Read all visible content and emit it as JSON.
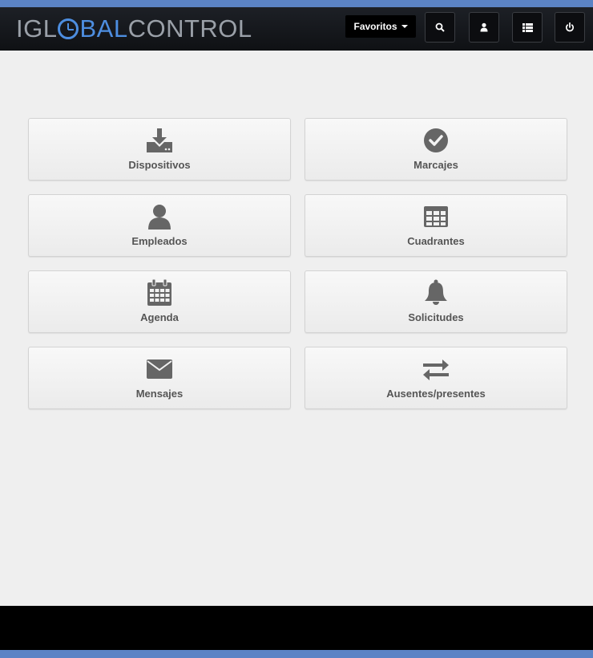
{
  "header": {
    "logo_prefix": "IGL",
    "logo_middle": "BAL",
    "logo_suffix": "CONTROL",
    "favorites_label": "Favoritos",
    "icons": [
      "search-icon",
      "user-icon",
      "list-icon",
      "power-icon"
    ]
  },
  "tiles": [
    {
      "label": "Dispositivos",
      "icon": "download-icon"
    },
    {
      "label": "Marcajes",
      "icon": "check-circle-icon"
    },
    {
      "label": "Empleados",
      "icon": "user-icon"
    },
    {
      "label": "Cuadrantes",
      "icon": "table-icon"
    },
    {
      "label": "Agenda",
      "icon": "calendar-icon"
    },
    {
      "label": "Solicitudes",
      "icon": "bell-icon"
    },
    {
      "label": "Mensajes",
      "icon": "envelope-icon"
    },
    {
      "label": "Ausentes/presentes",
      "icon": "exchange-icon"
    }
  ],
  "colors": {
    "accent": "#5b83c5",
    "logo_blue": "#4d8ee0",
    "icon_gray": "#666666",
    "background": "#efefef"
  }
}
